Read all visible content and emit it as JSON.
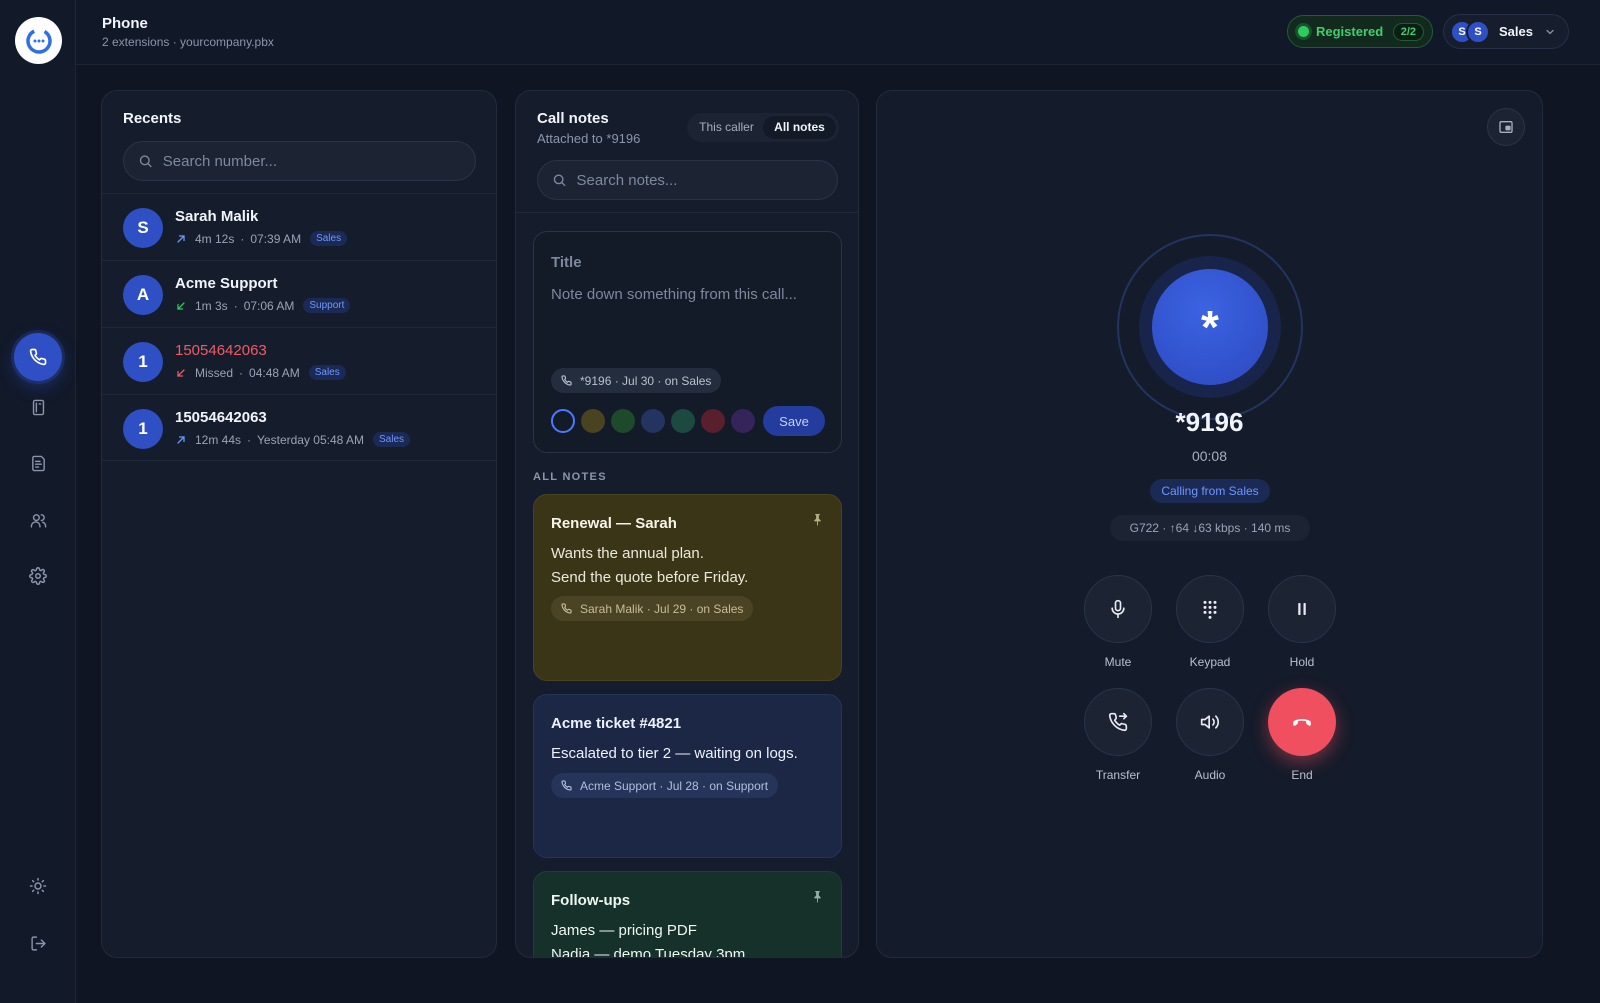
{
  "header": {
    "title": "Phone",
    "subtitle": "2 extensions · yourcompany.pbx",
    "registration": {
      "label": "Registered",
      "count": "2/2",
      "color": "#2ecc5e"
    },
    "account": {
      "avatars": [
        "S",
        "S"
      ],
      "label": "Sales"
    }
  },
  "sidebar": {
    "items": [
      {
        "name": "phone",
        "icon": "phone-icon",
        "active": true
      },
      {
        "name": "contacts-book",
        "icon": "contact-book-icon",
        "active": false
      },
      {
        "name": "notes",
        "icon": "notes-icon",
        "active": false
      },
      {
        "name": "team",
        "icon": "users-icon",
        "active": false
      },
      {
        "name": "settings",
        "icon": "gear-icon",
        "active": false
      }
    ],
    "bottom": [
      {
        "name": "theme",
        "icon": "sun-icon"
      },
      {
        "name": "logout",
        "icon": "logout-icon"
      }
    ]
  },
  "recents": {
    "title": "Recents",
    "search_placeholder": "Search number...",
    "items": [
      {
        "initial": "S",
        "name": "Sarah Malik",
        "direction": "outgoing",
        "duration": "4m 12s",
        "time": "07:39 AM",
        "tag": "Sales",
        "missed": false
      },
      {
        "initial": "A",
        "name": "Acme Support",
        "direction": "incoming",
        "duration": "1m 3s",
        "time": "07:06 AM",
        "tag": "Support",
        "missed": false
      },
      {
        "initial": "1",
        "name": "15054642063",
        "direction": "missed",
        "duration": "Missed",
        "time": "04:48 AM",
        "tag": "Sales",
        "missed": true
      },
      {
        "initial": "1",
        "name": "15054642063",
        "direction": "outgoing",
        "duration": "12m 44s",
        "time": "Yesterday 05:48 AM",
        "tag": "Sales",
        "missed": false
      }
    ]
  },
  "notes": {
    "title": "Call notes",
    "subtitle": "Attached to *9196",
    "filter": {
      "options": [
        "This caller",
        "All notes"
      ],
      "selected": "All notes"
    },
    "search_placeholder": "Search notes...",
    "composer": {
      "title_placeholder": "Title",
      "body_placeholder": "Note down something from this call...",
      "chip": "*9196 · Jul 30 · on Sales",
      "colors": [
        "none",
        "#4a4320",
        "#1d4a2a",
        "#22345f",
        "#1d4a40",
        "#5a1f2c",
        "#35245a"
      ],
      "selected_color": "none",
      "save_label": "Save"
    },
    "all_notes_label": "ALL NOTES",
    "cards": [
      {
        "title": "Renewal — Sarah",
        "lines": [
          "Wants the annual plan.",
          "Send the quote before Friday."
        ],
        "chip": "Sarah Malik · Jul 29 · on Sales",
        "pinned": true,
        "color": "#3b3517"
      },
      {
        "title": "Acme ticket #4821",
        "lines": [
          "Escalated to tier 2 — waiting on logs."
        ],
        "chip": "Acme Support · Jul 28 · on Support",
        "pinned": false,
        "color": "#1b2744"
      },
      {
        "title": "Follow-ups",
        "lines": [
          "James — pricing PDF",
          "Nadia — demo Tuesday 3pm"
        ],
        "chip": "",
        "pinned": true,
        "color": "#163129"
      }
    ]
  },
  "call": {
    "avatar_symbol": "*",
    "number": "*9196",
    "timer": "00:08",
    "calling_from": "Calling from Sales",
    "stats": "G722 · ↑64 ↓63 kbps · 140 ms",
    "controls": [
      {
        "label": "Mute",
        "icon": "microphone-icon"
      },
      {
        "label": "Keypad",
        "icon": "keypad-icon"
      },
      {
        "label": "Hold",
        "icon": "pause-icon"
      },
      {
        "label": "Transfer",
        "icon": "transfer-icon"
      },
      {
        "label": "Audio",
        "icon": "speaker-icon"
      },
      {
        "label": "End",
        "icon": "hangup-icon"
      }
    ],
    "end_color": "#ef4f5e"
  }
}
